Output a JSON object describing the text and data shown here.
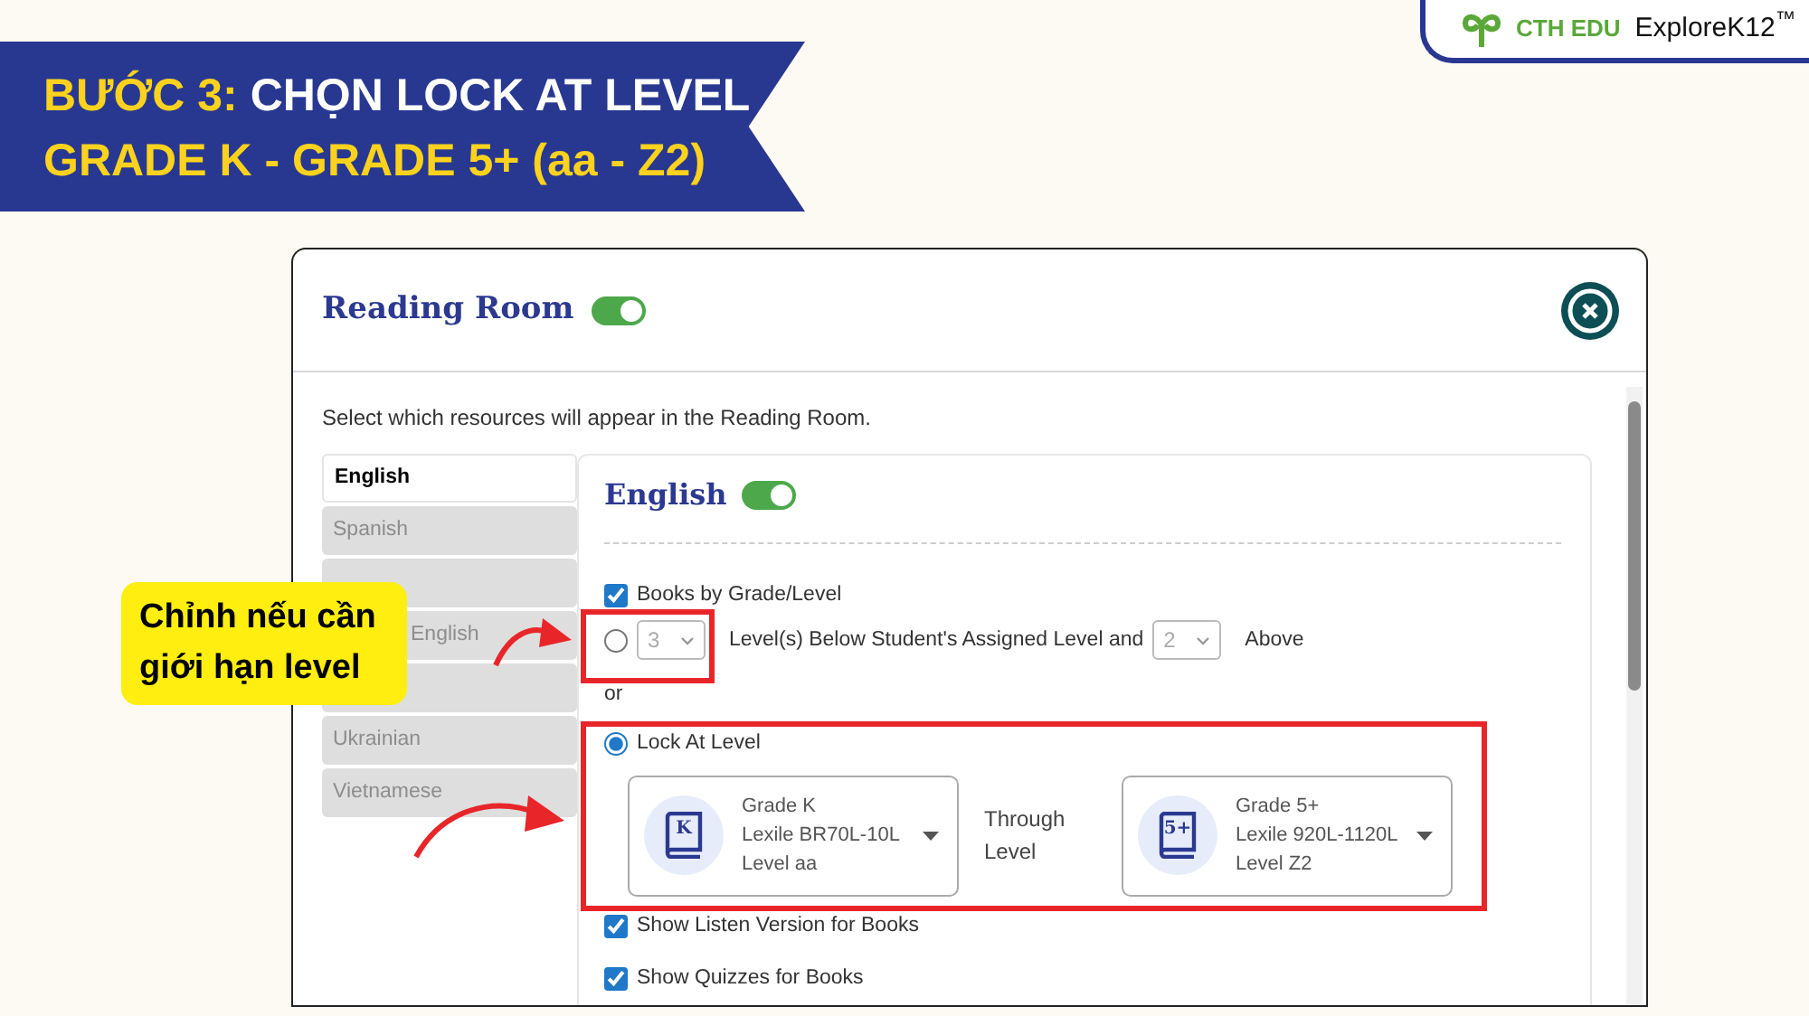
{
  "banner": {
    "step_label": "BƯỚC 3:",
    "title_line_1": "CHỌN LOCK AT LEVEL",
    "title_line_2": "GRADE K - GRADE 5+ (aa - Z2)"
  },
  "logos": {
    "partner": "CTH EDU",
    "product": "ExploreK12$^{™}$"
  },
  "dialog": {
    "title": "Reading Room",
    "enabled": true,
    "intro": "Select which resources will appear in the Reading Room.",
    "languages": [
      {
        "label": "English",
        "selected": true
      },
      {
        "label": "Spanish",
        "selected": false
      },
      {
        "selected": false
      },
      {
        "label": "English",
        "selected": false,
        "partly_hidden": true
      },
      {
        "selected": false
      },
      {
        "label": "Ukrainian",
        "selected": false
      },
      {
        "label": "Vietnamese",
        "selected": false
      }
    ],
    "section": {
      "title": "English",
      "enabled": true,
      "books_by_level": {
        "label": "Books by Grade/Level",
        "checked": true
      },
      "range_option": {
        "selected": false,
        "below": {
          "value": "3",
          "disabled": true
        },
        "middle_text": "Level(s) Below Student's Assigned Level and",
        "above": {
          "value": "2",
          "disabled": true
        },
        "end_text": "Above"
      },
      "or_text": "or",
      "lock_option": {
        "label": "Lock At Level",
        "selected": true
      },
      "from_level": {
        "badge": "K",
        "lines": [
          "Grade K",
          "Lexile BR70L-10L",
          "Level aa"
        ]
      },
      "through_text": "Through Level",
      "to_level": {
        "badge": "5+",
        "lines": [
          "Grade 5+",
          "Lexile 920L-1120L",
          "Level Z2"
        ]
      },
      "extras": [
        {
          "label": "Show Listen Version for Books",
          "checked": true
        },
        {
          "label": "Show Quizzes for Books",
          "checked": true
        }
      ]
    }
  },
  "callout": {
    "text": "Chỉnh nếu cần giới hạn level"
  }
}
